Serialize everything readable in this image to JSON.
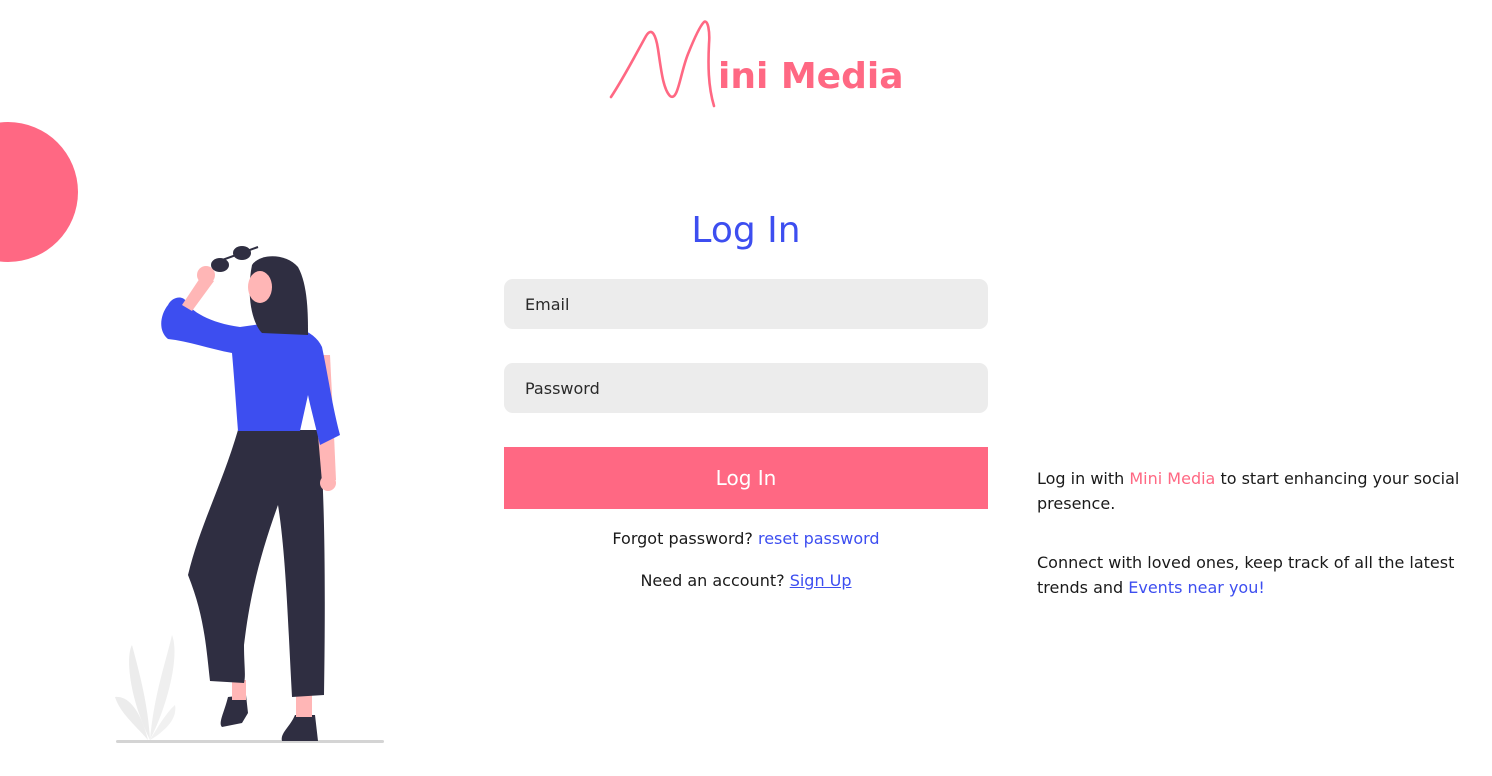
{
  "brand": {
    "name": "ini Media",
    "accent_color": "#ff6883",
    "primary_color": "#3d4ef0"
  },
  "login": {
    "title": "Log In",
    "email_placeholder": "Email",
    "password_placeholder": "Password",
    "submit_label": "Log In",
    "forgot_text": "Forgot password? ",
    "forgot_link": "reset password",
    "signup_text": "Need an account? ",
    "signup_link": "Sign Up"
  },
  "info": {
    "p1_before": "Log in with ",
    "p1_brand": "Mini Media",
    "p1_after": " to start enhancing your social presence.",
    "p2_before": "Connect with loved ones, keep track of all the latest trends and ",
    "p2_link": "Events near you!"
  },
  "illustration": {
    "icon": "woman-with-sunglasses-illustration",
    "shirt_color": "#3d4ef0",
    "pants_color": "#2f2e41",
    "skin_color": "#ffb6b6"
  }
}
